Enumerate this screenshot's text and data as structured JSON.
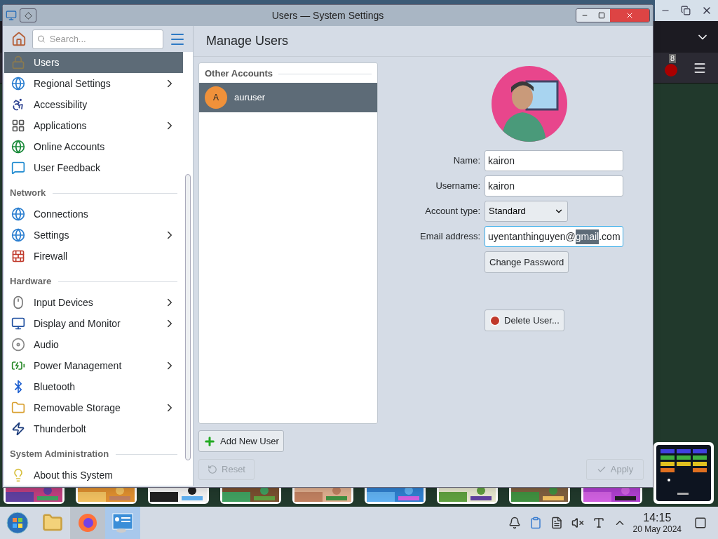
{
  "window": {
    "title": "Users — System Settings"
  },
  "sidebar": {
    "search": {
      "placeholder": "Search..."
    },
    "sections": [
      {
        "items": [
          {
            "label": "Users",
            "selected": true,
            "has_submenu": false
          },
          {
            "label": "Regional Settings",
            "selected": false,
            "has_submenu": true
          },
          {
            "label": "Accessibility",
            "selected": false,
            "has_submenu": false
          },
          {
            "label": "Applications",
            "selected": false,
            "has_submenu": true
          },
          {
            "label": "Online Accounts",
            "selected": false,
            "has_submenu": false
          },
          {
            "label": "User Feedback",
            "selected": false,
            "has_submenu": false
          }
        ]
      },
      {
        "heading": "Network",
        "items": [
          {
            "label": "Connections",
            "selected": false,
            "has_submenu": false
          },
          {
            "label": "Settings",
            "selected": false,
            "has_submenu": true
          },
          {
            "label": "Firewall",
            "selected": false,
            "has_submenu": false
          }
        ]
      },
      {
        "heading": "Hardware",
        "items": [
          {
            "label": "Input Devices",
            "selected": false,
            "has_submenu": true
          },
          {
            "label": "Display and Monitor",
            "selected": false,
            "has_submenu": true
          },
          {
            "label": "Audio",
            "selected": false,
            "has_submenu": false
          },
          {
            "label": "Power Management",
            "selected": false,
            "has_submenu": true
          },
          {
            "label": "Bluetooth",
            "selected": false,
            "has_submenu": false
          },
          {
            "label": "Removable Storage",
            "selected": false,
            "has_submenu": true
          },
          {
            "label": "Thunderbolt",
            "selected": false,
            "has_submenu": false
          }
        ]
      },
      {
        "heading": "System Administration",
        "items": [
          {
            "label": "About this System",
            "selected": false,
            "has_submenu": false
          }
        ]
      }
    ]
  },
  "page": {
    "title": "Manage Users"
  },
  "accounts": {
    "heading": "Other Accounts",
    "items": [
      {
        "initial": "A",
        "name": "auruser",
        "selected": true
      }
    ]
  },
  "form": {
    "fields": [
      {
        "label": "Name:",
        "kind": "text",
        "focused": false,
        "value": "kairon"
      },
      {
        "label": "Username:",
        "kind": "text",
        "focused": false,
        "value": "kairon"
      },
      {
        "label": "Account type:",
        "kind": "select",
        "value": "Standard"
      },
      {
        "label": "Email address:",
        "kind": "text",
        "focused": true,
        "parts": [
          {
            "text": "uyentanthinguyen@",
            "selected": false
          },
          {
            "text": "gmail",
            "selected": true
          },
          {
            "text": ".com",
            "selected": false
          }
        ]
      }
    ],
    "change_password": "Change Password",
    "delete_user": "Delete User..."
  },
  "add_user": "Add New User",
  "footer": {
    "reset": {
      "label": "Reset",
      "disabled": true
    },
    "apply": {
      "label": "Apply",
      "disabled": true
    }
  },
  "browser": {
    "badge": "8"
  },
  "taskbar": {
    "apps": [
      {
        "kind": "start",
        "selected": false,
        "hovered": false
      },
      {
        "kind": "files",
        "selected": false,
        "hovered": false
      },
      {
        "kind": "firefox",
        "selected": false,
        "hovered": true
      },
      {
        "kind": "settings",
        "selected": true
      }
    ],
    "clock": {
      "time": "14:15",
      "date": "20 May 2024"
    }
  }
}
